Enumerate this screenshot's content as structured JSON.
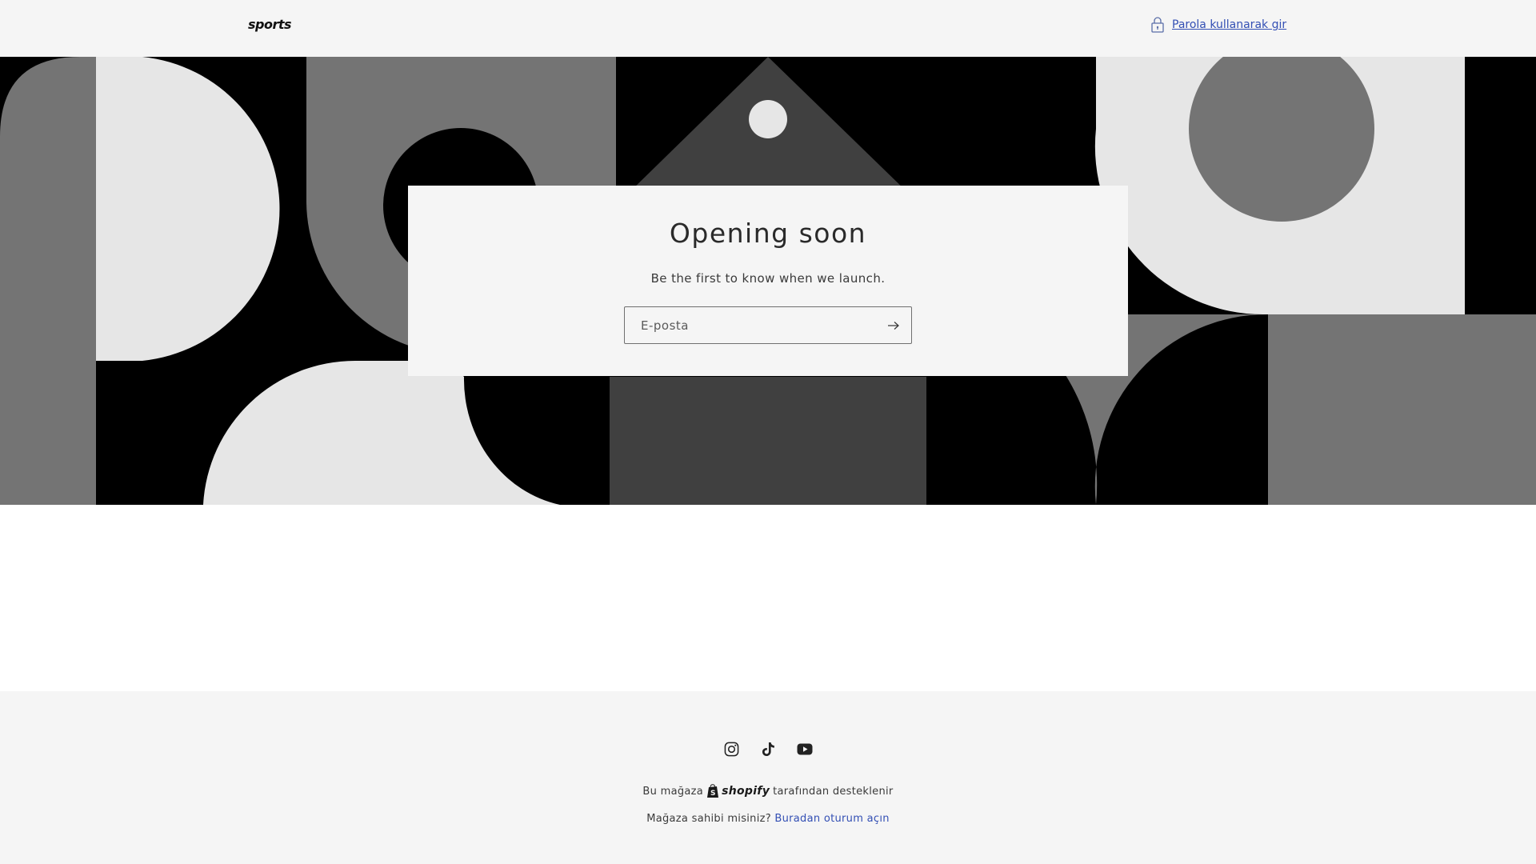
{
  "header": {
    "logo_text": "sports",
    "password_link": "Parola kullanarak gir",
    "password_icon": "lock-icon"
  },
  "card": {
    "title": "Opening soon",
    "subtitle": "Be the first to know when we launch.",
    "email_placeholder": "E-posta",
    "email_value": "",
    "submit_icon": "arrow-right-icon"
  },
  "footer": {
    "social_icons": [
      "instagram-icon",
      "tiktok-icon",
      "youtube-icon"
    ],
    "powered_prefix": "Bu mağaza",
    "powered_brand": "shopify",
    "powered_suffix": "tarafından desteklenir",
    "owner_question": "Mağaza sahibi misiniz?",
    "owner_link": "Buradan oturum açın"
  },
  "colors": {
    "header_bg": "#f5f5f5",
    "footer_bg": "#f5f5f5",
    "link": "#334fb4",
    "banner_black": "#000000",
    "banner_gray": "#747474",
    "banner_light": "#e6e6e6",
    "banner_dark": "#404040"
  }
}
